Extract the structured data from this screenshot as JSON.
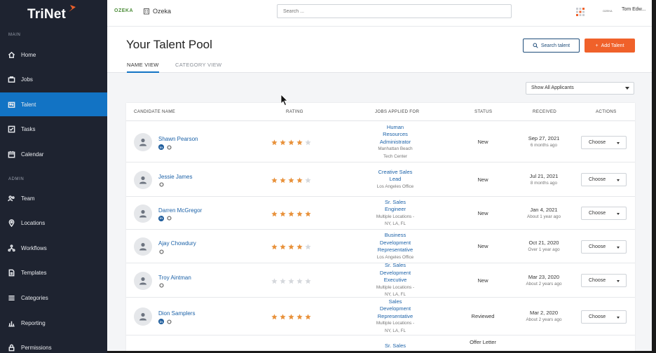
{
  "sidebar": {
    "logo": "TriNet",
    "section_main": "MAIN",
    "section_admin": "ADMIN",
    "main_items": [
      {
        "label": "Home",
        "icon": "home-icon"
      },
      {
        "label": "Jobs",
        "icon": "briefcase-icon"
      },
      {
        "label": "Talent",
        "icon": "id-card-icon",
        "active": true
      },
      {
        "label": "Tasks",
        "icon": "tasks-icon"
      },
      {
        "label": "Calendar",
        "icon": "calendar-icon"
      }
    ],
    "admin_items": [
      {
        "label": "Team",
        "icon": "team-icon"
      },
      {
        "label": "Locations",
        "icon": "location-pin-icon"
      },
      {
        "label": "Workflows",
        "icon": "workflow-icon"
      },
      {
        "label": "Templates",
        "icon": "template-icon"
      },
      {
        "label": "Categories",
        "icon": "list-icon"
      },
      {
        "label": "Reporting",
        "icon": "bar-chart-icon"
      },
      {
        "label": "Permissions",
        "icon": "lock-icon"
      }
    ],
    "active_color": "#1273c4",
    "bg_color": "#1e2330"
  },
  "topbar": {
    "brand_logo": "OZEKA",
    "brand_name": "Ozeka",
    "search_placeholder": "Search ...",
    "user_logo": "OZEKA",
    "user_name": "Tom Edw..."
  },
  "header": {
    "title": "Your Talent Pool",
    "tabs": [
      "NAME VIEW",
      "CATEGORY VIEW"
    ],
    "search_button": "Search talent",
    "add_button": "Add Talent",
    "add_color": "#f0612a"
  },
  "filter": {
    "selected": "Show All Applicants"
  },
  "table": {
    "columns": [
      "CANDIDATE NAME",
      "RATING",
      "JOBS APPLIED FOR",
      "STATUS",
      "RECEIVED",
      "ACTIONS"
    ],
    "rows": [
      {
        "name": "Shawn Pearson",
        "linkedin": true,
        "rating": 4,
        "job": [
          "Human",
          "Resources",
          "Administrator"
        ],
        "location": [
          "Manhattan Beach",
          "Tech Center"
        ],
        "status": "New",
        "date": "Sep 27, 2021",
        "ago": "6 months ago",
        "action": "Choose"
      },
      {
        "name": "Jessie James",
        "linkedin": false,
        "rating": 4,
        "job": [
          "Creative Sales",
          "Lead"
        ],
        "location": [
          "Los Angeles Office"
        ],
        "status": "New",
        "date": "Jul 21, 2021",
        "ago": "8 months ago",
        "action": "Choose"
      },
      {
        "name": "Darren McGregor",
        "linkedin": true,
        "rating": 5,
        "job": [
          "Sr. Sales",
          "Engineer"
        ],
        "location": [
          "Multiple Locations -",
          "NY, LA, FL"
        ],
        "status": "New",
        "date": "Jan 4, 2021",
        "ago": "About 1 year ago",
        "action": "Choose"
      },
      {
        "name": "Ajay Chowdury",
        "linkedin": false,
        "rating": 4,
        "job": [
          "Business",
          "Development",
          "Representative"
        ],
        "location": [
          "Los Angeles Office"
        ],
        "status": "New",
        "date": "Oct 21, 2020",
        "ago": "Over 1 year ago",
        "action": "Choose"
      },
      {
        "name": "Troy Aintman",
        "linkedin": false,
        "rating": 0,
        "job": [
          "Sr. Sales",
          "Development",
          "Executive"
        ],
        "location": [
          "Multiple Locations -",
          "NY, LA, FL"
        ],
        "status": "New",
        "date": "Mar 23, 2020",
        "ago": "About 2 years ago",
        "action": "Choose"
      },
      {
        "name": "Dion Samplers",
        "linkedin": true,
        "rating": 5,
        "job": [
          "Sales",
          "Development",
          "Representative"
        ],
        "location": [
          "Multiple Locations -",
          "NY, LA, FL"
        ],
        "status": "Reviewed",
        "date": "Mar 2, 2020",
        "ago": "About 2 years ago",
        "action": "Choose"
      },
      {
        "name": "",
        "linkedin": false,
        "rating": -1,
        "job": [
          "Sr. Sales"
        ],
        "location": [],
        "status": "Offer Letter",
        "date": "",
        "ago": "",
        "action": ""
      }
    ],
    "star_on": "#e8913a",
    "star_off": "#d5d8dc"
  }
}
